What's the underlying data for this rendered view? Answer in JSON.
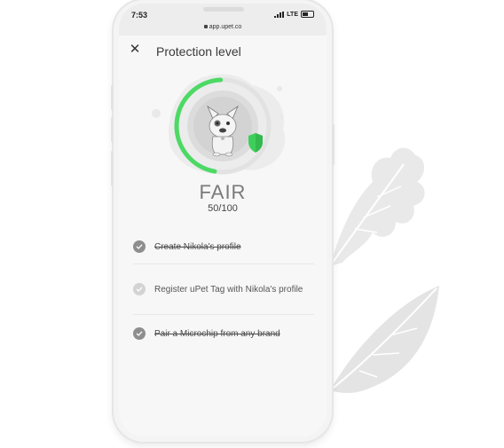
{
  "status_bar": {
    "time": "7:53",
    "network": "LTE"
  },
  "browser": {
    "url": "app.upet.co"
  },
  "header": {
    "close_icon": "close-icon",
    "title": "Protection level"
  },
  "protection": {
    "level": "FAIR",
    "score": "50/100",
    "progress_fraction": 0.5,
    "progress_color": "#4cd964",
    "shield_color": "#3ecf5a"
  },
  "tasks": [
    {
      "label": "Create Nikola's profile",
      "completed": true
    },
    {
      "label": "Register uPet Tag with Nikola's profile",
      "completed": false
    },
    {
      "label": "Pair a Microchip from any brand",
      "completed": true
    }
  ],
  "colors": {
    "leaf": "#e6e6e6",
    "check_done": "#8e8e8e",
    "check_pending": "#d3d3d3"
  }
}
